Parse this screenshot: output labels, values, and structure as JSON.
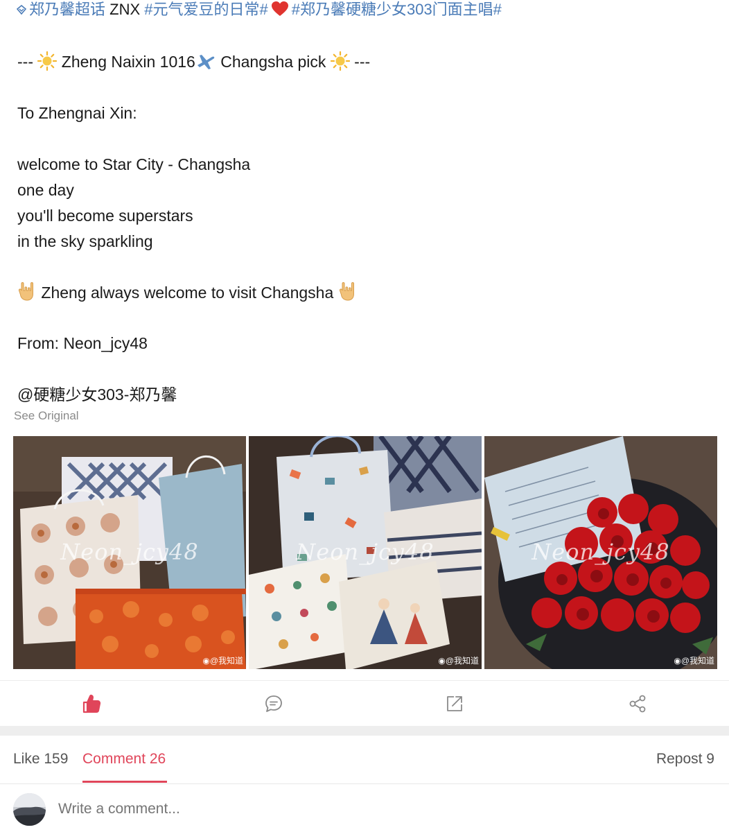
{
  "post": {
    "super_topic": "郑乃馨超话",
    "plain_tag": " ZNX ",
    "hashtag_1": "#元气爱豆的日常#",
    "hashtag_2": "#郑乃馨硬糖少女303门面主唱#",
    "header_left": "--- ",
    "header_text_1": " Zheng Naixin 1016",
    "header_text_2": " Changsha pick ",
    "header_right": " ---",
    "greeting": "To Zhengnai Xin:",
    "lines": [
      "welcome to Star City - Changsha",
      "one day",
      "you'll become superstars",
      "in the sky sparkling"
    ],
    "welcome_line": " Zheng always welcome to visit Changsha ",
    "from_line": "From: Neon_jcy48",
    "mention": "@硬糖少女303-郑乃馨",
    "see_original": "See Original"
  },
  "photos": [
    {
      "watermark": "Neon_jcy48",
      "credit": "@我知道",
      "subject": "gift bags and orange box"
    },
    {
      "watermark": "Neon_jcy48",
      "credit": "@我知道",
      "subject": "patterned gift bags and boxes"
    },
    {
      "watermark": "Neon_jcy48",
      "credit": "@我知道",
      "subject": "red roses bouquet with card"
    }
  ],
  "actions": {
    "like_icon": "thumbs-up-icon",
    "comment_icon": "comment-bubble-icon",
    "repost_icon": "share-out-icon",
    "share_icon": "share-nodes-icon"
  },
  "tabs": {
    "like": "Like 159",
    "comment": "Comment 26",
    "repost": "Repost 9"
  },
  "comment_box": {
    "placeholder": "Write a comment..."
  },
  "colors": {
    "link": "#4a7bb7",
    "accent": "#e0455a",
    "muted": "#8a8a8a"
  }
}
